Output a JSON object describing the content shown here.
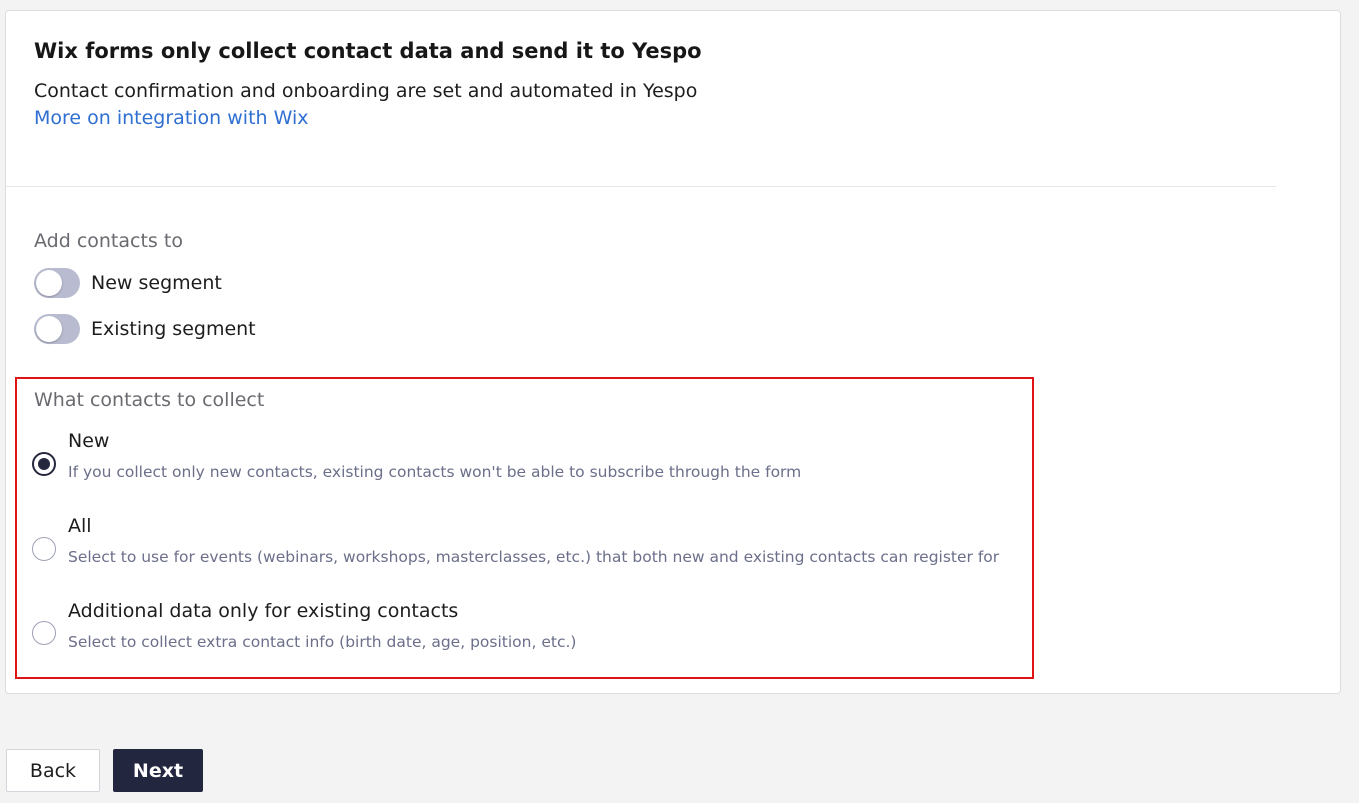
{
  "header": {
    "title": "Wix forms only collect contact data and send it to Yespo",
    "subtitle": "Contact confirmation and onboarding are set and automated in Yespo",
    "link_label": "More on integration with Wix"
  },
  "add_contacts": {
    "label": "Add contacts to",
    "toggles": [
      {
        "label": "New segment",
        "on": false
      },
      {
        "label": "Existing segment",
        "on": false
      }
    ]
  },
  "collect": {
    "label": "What contacts to collect",
    "selected": "New",
    "options": [
      {
        "title": "New",
        "description": "If you collect only new contacts, existing contacts won't be able to subscribe through the form"
      },
      {
        "title": "All",
        "description": "Select to use for events (webinars, workshops, masterclasses, etc.) that both new and existing contacts can register for"
      },
      {
        "title": "Additional data only for existing contacts",
        "description": "Select to collect extra contact info (birth date, age, position, etc.)"
      }
    ]
  },
  "footer": {
    "back_label": "Back",
    "next_label": "Next"
  },
  "colors": {
    "accent_link": "#2f6fd1",
    "primary_button": "#22263e",
    "highlight_border": "#e01414",
    "toggle_off": "#b9bcd0"
  }
}
